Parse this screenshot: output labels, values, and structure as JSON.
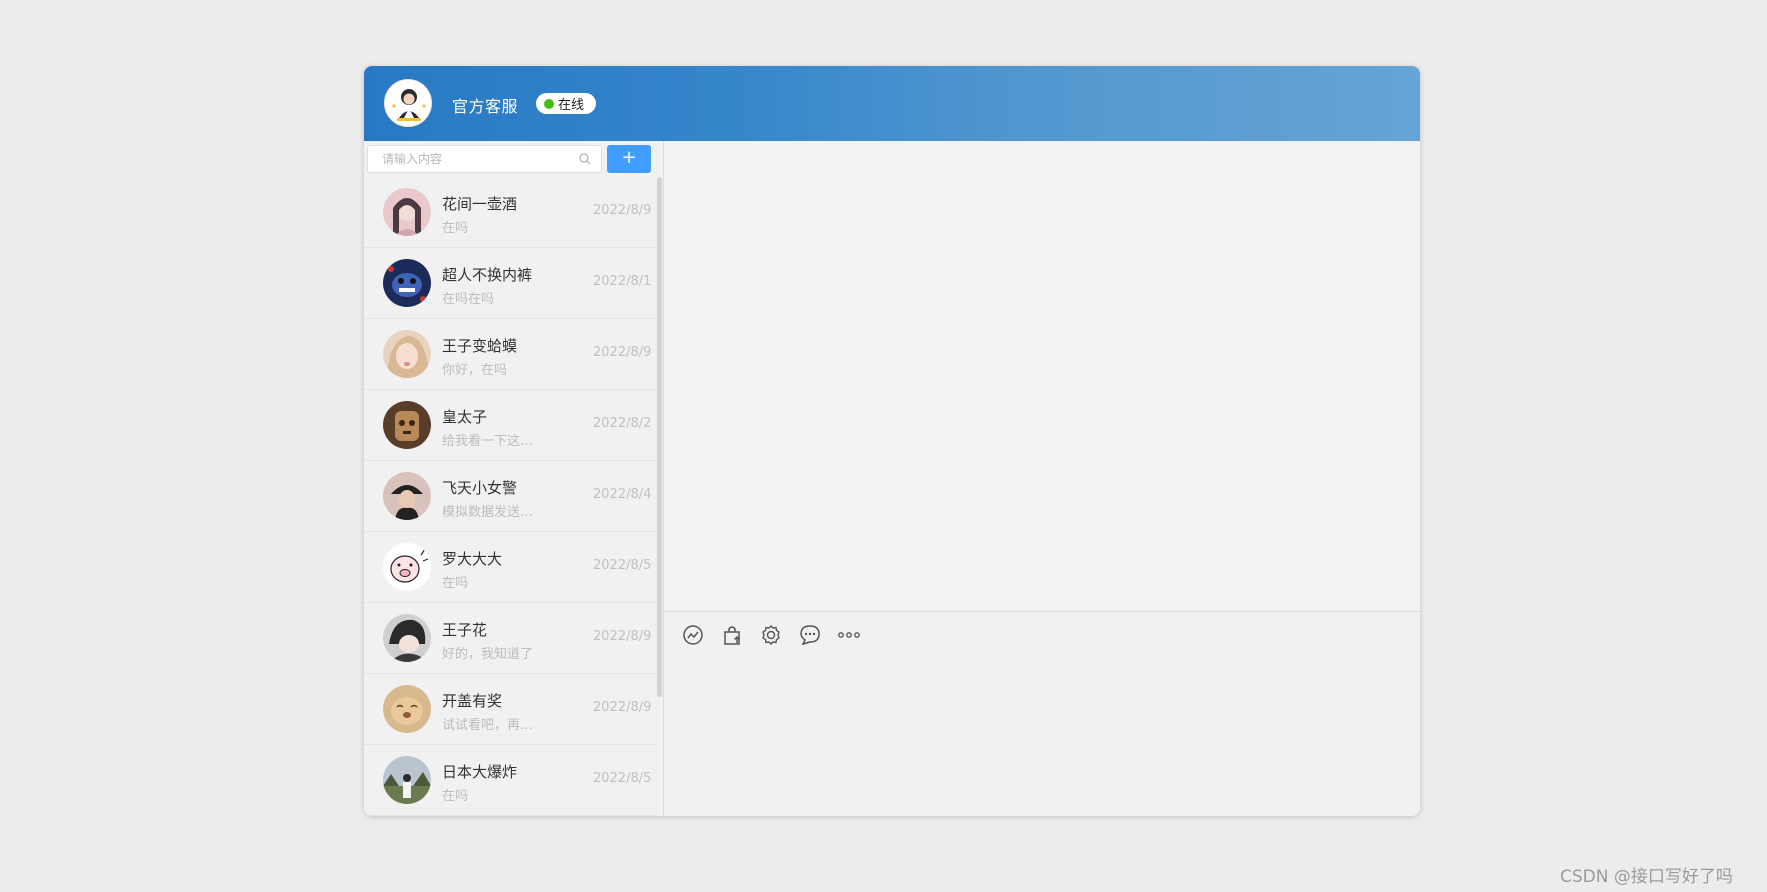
{
  "header": {
    "title": "官方客服",
    "status": "在线",
    "status_color": "#43c00f",
    "brand_color": "#2779c3"
  },
  "search": {
    "placeholder": "请输入内容",
    "value": "",
    "icon": "search-icon"
  },
  "add_button": {
    "label": "+",
    "color": "#409eff"
  },
  "contacts": [
    {
      "name": "花间一壶酒",
      "preview": "在吗",
      "date": "2022/8/9"
    },
    {
      "name": "超人不换内裤",
      "preview": "在吗在吗",
      "date": "2022/8/1"
    },
    {
      "name": "王子变蛤蟆",
      "preview": "你好，在吗",
      "date": "2022/8/9"
    },
    {
      "name": "皇太子",
      "preview": "给我看一下这…",
      "date": "2022/8/2"
    },
    {
      "name": "飞天小女警",
      "preview": "模拟数据发送…",
      "date": "2022/8/4"
    },
    {
      "name": "罗大大大",
      "preview": "在吗",
      "date": "2022/8/5"
    },
    {
      "name": "王子花",
      "preview": "好的，我知道了",
      "date": "2022/8/9"
    },
    {
      "name": "开盖有奖",
      "preview": "试试看吧，再…",
      "date": "2022/8/9"
    },
    {
      "name": "日本大爆炸",
      "preview": "在吗",
      "date": "2022/8/5"
    }
  ],
  "toolbar": {
    "icons": [
      "emoji-icon",
      "upload-icon",
      "settings-icon",
      "chat-bubble-icon",
      "more-icon"
    ]
  },
  "watermark": "CSDN @接口写好了吗"
}
